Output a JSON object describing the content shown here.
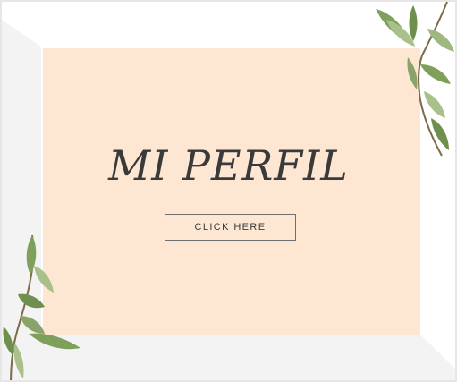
{
  "card": {
    "title": "MI PERFIL",
    "button_label": "CLICK HERE"
  },
  "decor": {
    "panel_color": "#fde7d2",
    "frame_color": "#f3f3f3",
    "leaf_color": "#8aa36a"
  }
}
